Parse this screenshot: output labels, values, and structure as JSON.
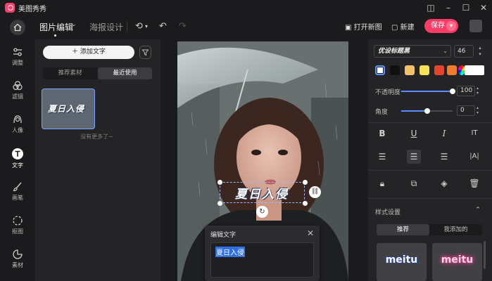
{
  "app": {
    "title": "美图秀秀"
  },
  "toolbar": {
    "tab_edit": "图片编辑",
    "tab_poster": "海报设计",
    "open_new": "打开新图",
    "new_label": "新建",
    "save_label": "保存"
  },
  "rail": [
    {
      "label": "调整",
      "icon": "sliders-icon"
    },
    {
      "label": "滤镜",
      "icon": "filter-circles-icon"
    },
    {
      "label": "人像",
      "icon": "portrait-icon"
    },
    {
      "label": "文字",
      "icon": "text-icon"
    },
    {
      "label": "画笔",
      "icon": "brush-icon"
    },
    {
      "label": "抠图",
      "icon": "cutout-icon"
    },
    {
      "label": "素材",
      "icon": "sticker-icon"
    }
  ],
  "panel": {
    "add_text": "＋ 添加文字",
    "seg_recommended": "推荐素材",
    "seg_recent": "最近使用",
    "thumb_text": "夏日入侵",
    "no_more": "没有更多了~"
  },
  "canvas": {
    "overlay_text": "夏日入侵"
  },
  "dialog": {
    "title": "编辑文字",
    "value": "夏日入侵"
  },
  "props": {
    "font_name": "优设标题黑",
    "font_size": "46",
    "opacity_label": "不透明度",
    "opacity_value": "100",
    "opacity_level": 1.0,
    "angle_label": "角度",
    "angle_value": "0",
    "angle_level": 0.5,
    "colors": [
      "#ffffff",
      "#111111",
      "#f2c26b",
      "#f6e15a",
      "#e5452d",
      "#ef7b2d"
    ],
    "style_section": "样式设置",
    "style_tab_recommended": "推荐",
    "style_tab_added": "我添加的",
    "style_sample_1": "meitu",
    "style_sample_2": "meitu"
  },
  "accent": "#ff3c67"
}
